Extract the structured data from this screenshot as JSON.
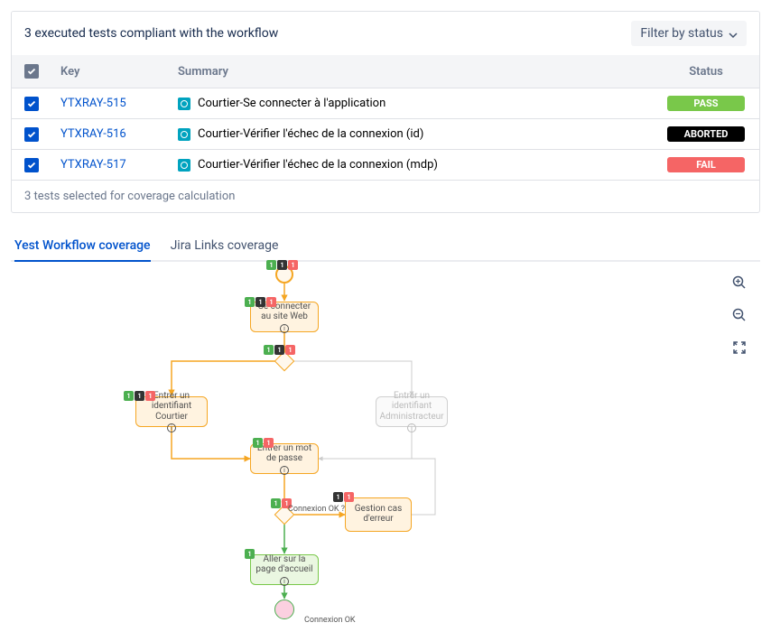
{
  "header": {
    "title": "3 executed tests compliant with the workflow",
    "filter_label": "Filter by status"
  },
  "table": {
    "cols": {
      "key": "Key",
      "summary": "Summary",
      "status": "Status"
    },
    "rows": [
      {
        "key": "YTXRAY-515",
        "summary": "Courtier-Se connecter à l'application",
        "status": "PASS",
        "status_class": "pass"
      },
      {
        "key": "YTXRAY-516",
        "summary": "Courtier-Vérifier l'échec de la connexion (id)",
        "status": "ABORTED",
        "status_class": "aborted"
      },
      {
        "key": "YTXRAY-517",
        "summary": "Courtier-Vérifier l'échec de la connexion (mdp)",
        "status": "FAIL",
        "status_class": "fail"
      }
    ],
    "footer": "3 tests selected for coverage calculation"
  },
  "tabs": {
    "active": "Yest Workflow coverage",
    "inactive": "Jira Links coverage"
  },
  "workflow": {
    "nodes": {
      "n1": "Se connecter au site Web",
      "n2": "Entrer un identifiant Courtier",
      "n3": "Entrer un identifiant Administracteur",
      "n4": "Entrer un mot de passe",
      "n5": "Gestion cas d'erreur",
      "n6": "Aller sur la page d'accueil",
      "d2_label": "Connexion OK ?",
      "end_label": "Connexion OK"
    }
  },
  "chart_data": {
    "type": "diagram",
    "workflow_type": "flowchart",
    "start": "start",
    "end": "end",
    "nodes": [
      {
        "id": "start",
        "type": "start"
      },
      {
        "id": "n1",
        "label": "Se connecter au site Web",
        "badges": {
          "pass": 1,
          "aborted": 1,
          "fail": 1
        },
        "style": "orange"
      },
      {
        "id": "d1",
        "type": "decision",
        "badges": {
          "pass": 1,
          "aborted": 1,
          "fail": 1
        }
      },
      {
        "id": "n2",
        "label": "Entrer un identifiant Courtier",
        "badges": {
          "pass": 1,
          "aborted": 1,
          "fail": 1
        },
        "style": "orange"
      },
      {
        "id": "n3",
        "label": "Entrer un identifiant Administracteur",
        "style": "grey_inactive"
      },
      {
        "id": "n4",
        "label": "Entrer un mot de passe",
        "badges": {
          "pass": 1,
          "fail": 1
        },
        "style": "orange"
      },
      {
        "id": "d2",
        "type": "decision",
        "label": "Connexion OK ?",
        "badges": {
          "pass": 1,
          "fail": 1
        }
      },
      {
        "id": "n5",
        "label": "Gestion cas d'erreur",
        "badges": {
          "aborted": 1,
          "fail": 1
        },
        "style": "orange",
        "subtype": "subprocess"
      },
      {
        "id": "n6",
        "label": "Aller sur la page d'accueil",
        "badges": {
          "pass": 1
        },
        "style": "green"
      },
      {
        "id": "end",
        "type": "end",
        "label": "Connexion OK"
      }
    ],
    "edges": [
      {
        "from": "start",
        "to": "n1"
      },
      {
        "from": "n1",
        "to": "d1"
      },
      {
        "from": "d1",
        "to": "n2"
      },
      {
        "from": "d1",
        "to": "n3"
      },
      {
        "from": "n2",
        "to": "n4"
      },
      {
        "from": "n3",
        "to": "n4"
      },
      {
        "from": "n4",
        "to": "d2"
      },
      {
        "from": "d2",
        "to": "n5"
      },
      {
        "from": "n5",
        "to": "n4"
      },
      {
        "from": "d2",
        "to": "n6"
      },
      {
        "from": "n6",
        "to": "end"
      }
    ]
  }
}
